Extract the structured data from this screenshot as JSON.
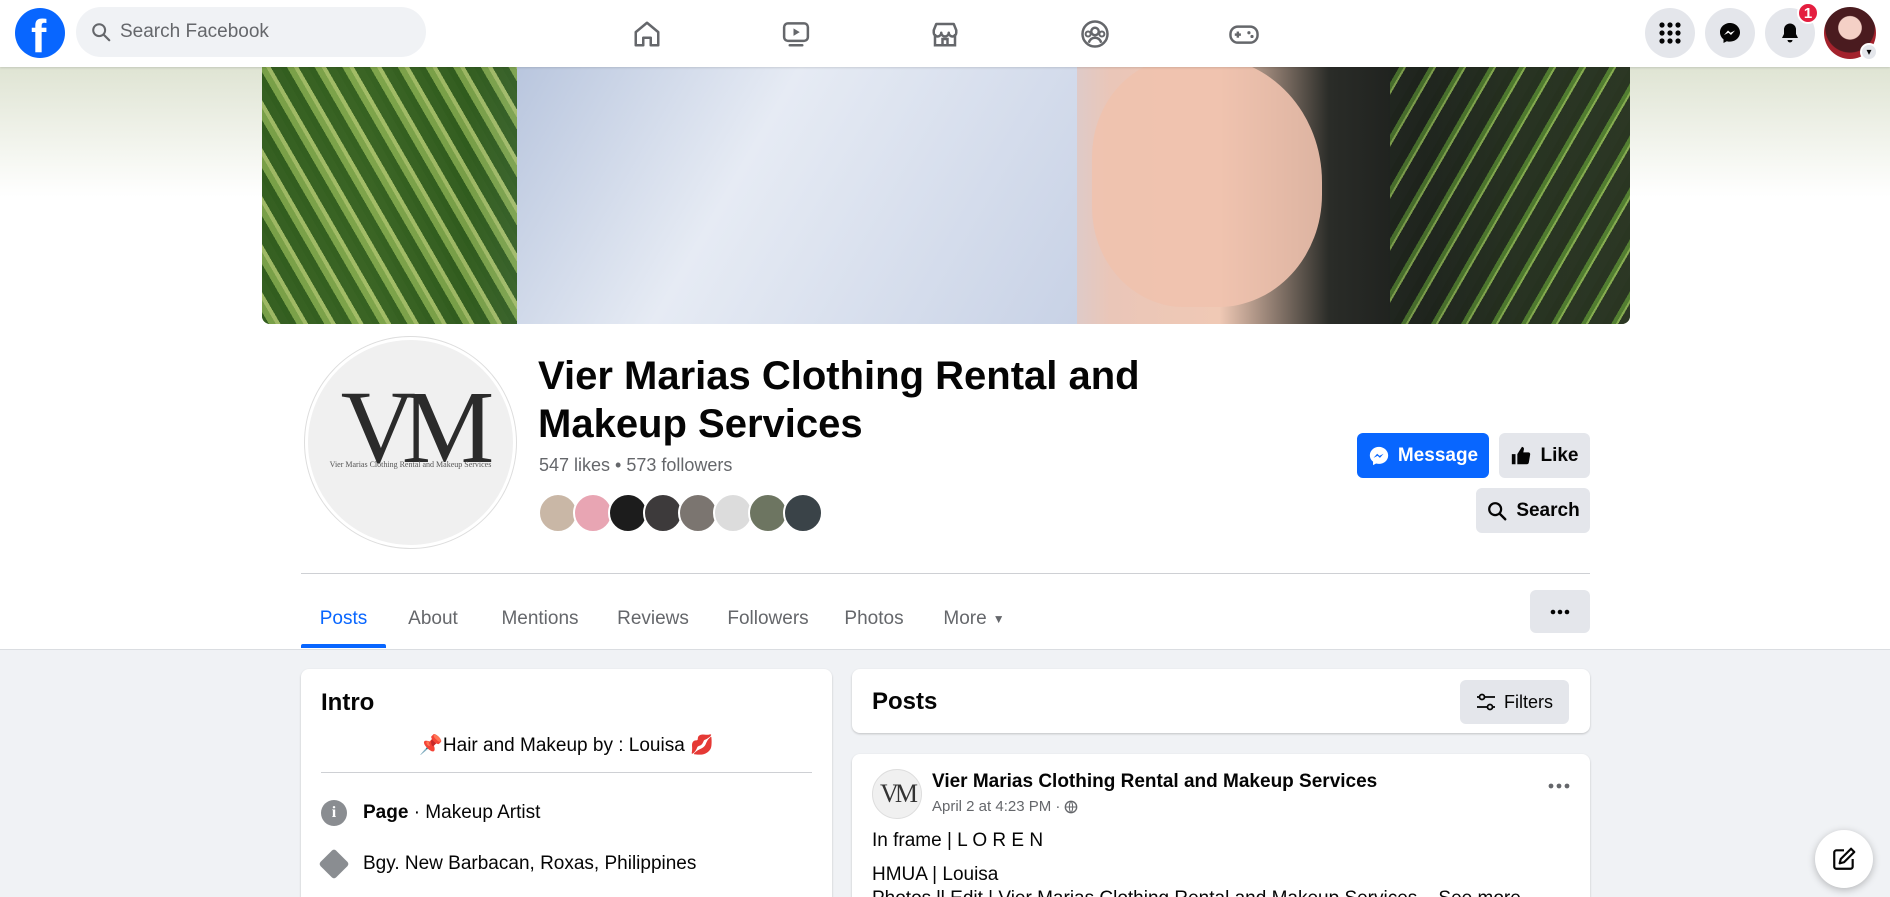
{
  "topbar": {
    "logo": "f",
    "search_placeholder": "Search Facebook",
    "nav_icons": [
      "home-icon",
      "video-icon",
      "marketplace-icon",
      "groups-icon",
      "gaming-icon"
    ],
    "notification_count": "1"
  },
  "page": {
    "title": "Vier Marias Clothing Rental and Makeup Services",
    "stats": "547 likes • 573 followers",
    "avatar_monogram": "VM",
    "avatar_subtext": "Vier Marias Clothing Rental and Makeup Services",
    "buttons": {
      "message": "Message",
      "like": "Like",
      "search": "Search"
    },
    "tabs": [
      "Posts",
      "About",
      "Mentions",
      "Reviews",
      "Followers",
      "Photos",
      "More"
    ],
    "active_tab": "Posts"
  },
  "intro": {
    "title": "Intro",
    "bio": "📌Hair and Makeup by : Louisa 💋",
    "category_label": "Page",
    "category_value": " · Makeup Artist",
    "location": "Bgy. New Barbacan, Roxas, Philippines"
  },
  "posts": {
    "title": "Posts",
    "filters_label": "Filters",
    "post": {
      "author": "Vier Marias Clothing Rental and Makeup Services",
      "time": "April 2 at 4:23 PM ·",
      "line1": "In frame |  L O R E N",
      "line2": "HMUA  |  Louisa",
      "line3": "Photos ll Edit  |  Vier Marias Clothing Rental and Makeup Services... See more"
    }
  },
  "colors": {
    "accent": "#0866ff",
    "badge": "#e41e3f",
    "secondary_bg": "#e4e6eb"
  }
}
